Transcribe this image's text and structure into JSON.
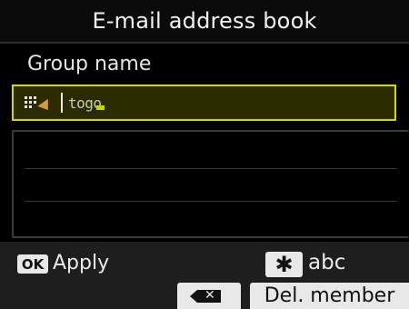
{
  "header": {
    "title": "E-mail address book"
  },
  "form": {
    "group_label": "Group name",
    "name_field": {
      "value": "togo"
    },
    "member_rows": 3
  },
  "footer": {
    "ok_key": "OK",
    "apply_label": "Apply",
    "star_key": "✱",
    "abc_label": "abc",
    "backspace_icon": "backspace-icon",
    "del_member_label": "Del. member"
  },
  "colors": {
    "background": "#000000",
    "field_highlight": "#d8d800",
    "key_face": "#e8e8e8"
  }
}
